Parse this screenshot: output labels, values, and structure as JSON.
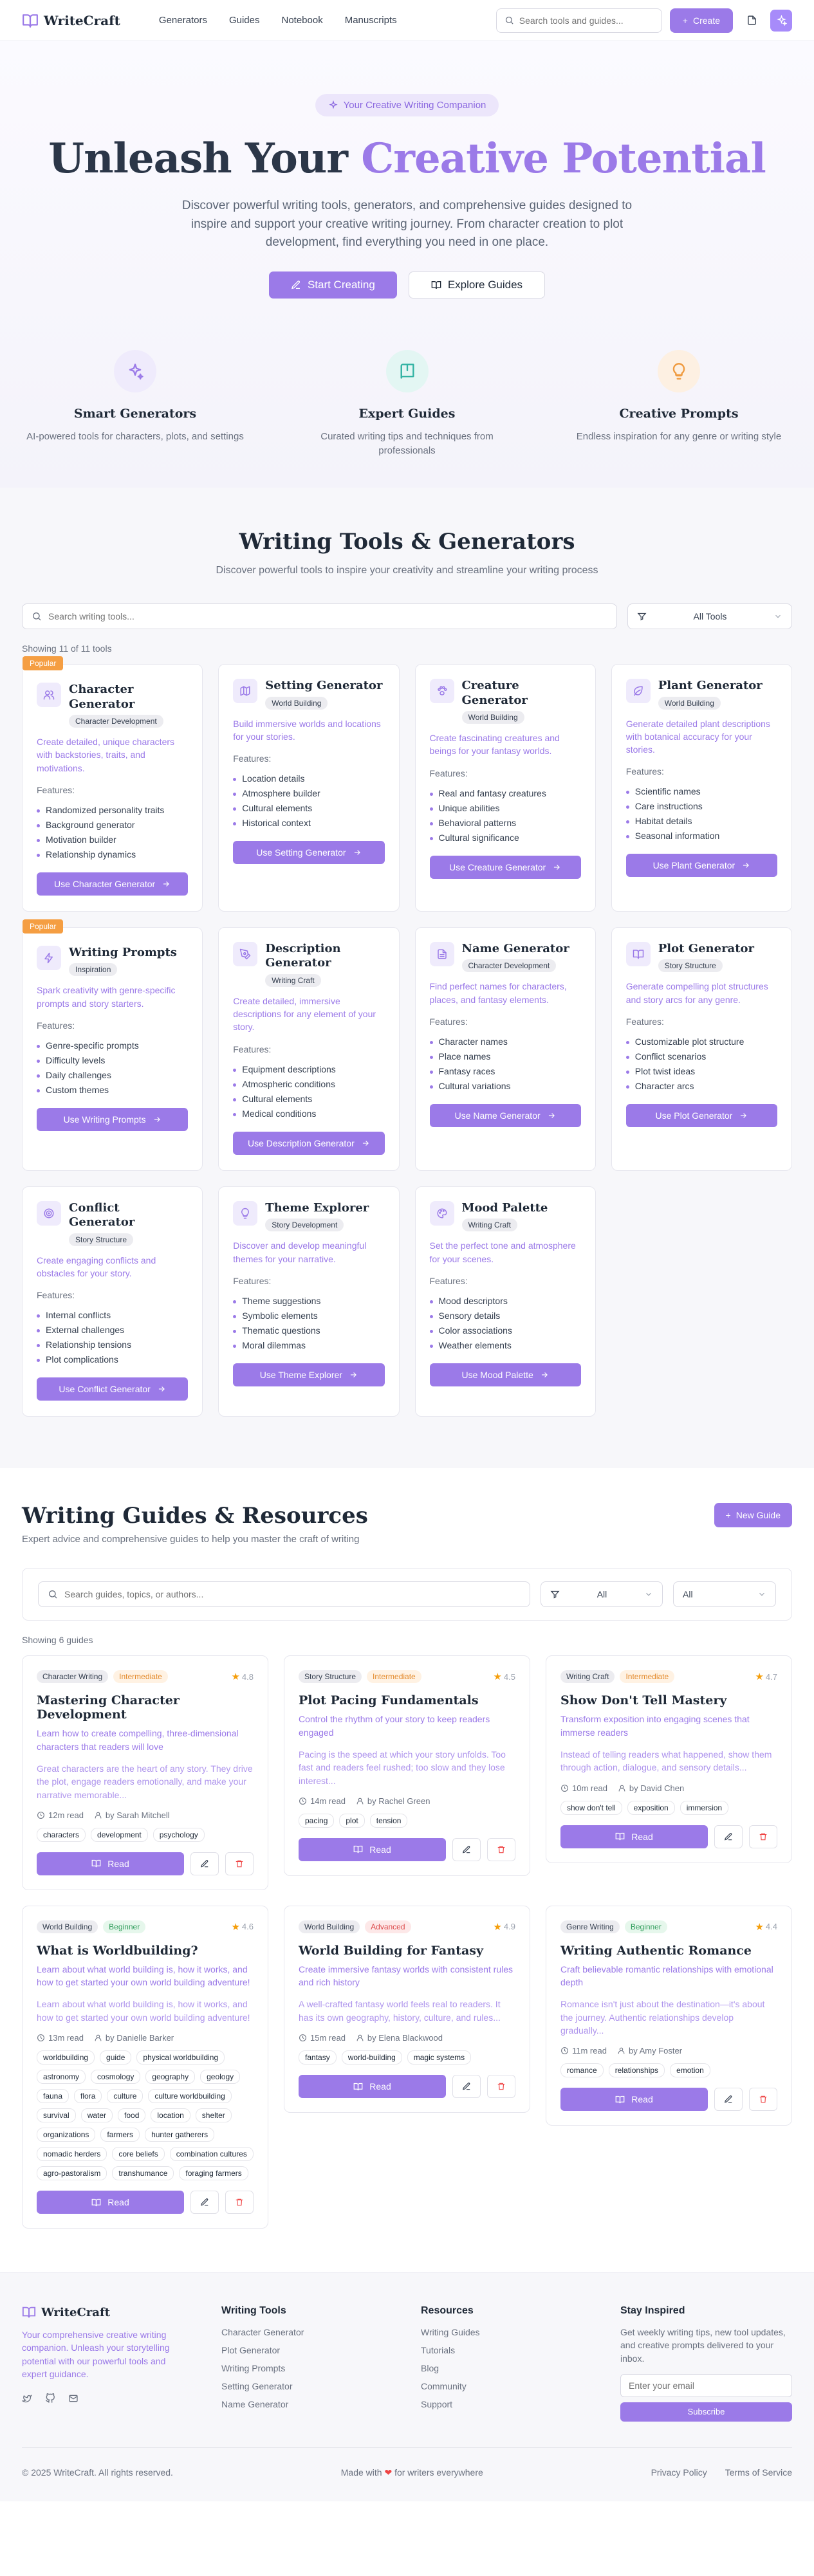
{
  "header": {
    "brand": "WriteCraft",
    "nav": [
      "Generators",
      "Guides",
      "Notebook",
      "Manuscripts"
    ],
    "search_placeholder": "Search tools and guides...",
    "create_label": "Create"
  },
  "hero": {
    "pill": "Your Creative Writing Companion",
    "title_a": "Unleash Your",
    "title_b": "Creative Potential",
    "lead": "Discover powerful writing tools, generators, and comprehensive guides designed to inspire and support your creative writing journey. From character creation to plot development, find everything you need in one place.",
    "btn_primary": "Start Creating",
    "btn_secondary": "Explore Guides",
    "features": [
      {
        "title": "Smart Generators",
        "desc": "AI-powered tools for characters, plots, and settings",
        "icon": "sparkles-icon",
        "bg": "#efebfc",
        "color": "#9b7ae8"
      },
      {
        "title": "Expert Guides",
        "desc": "Curated writing tips and techniques from professionals",
        "icon": "book-icon",
        "bg": "#e3f6f3",
        "color": "#32b3a3"
      },
      {
        "title": "Creative Prompts",
        "desc": "Endless inspiration for any genre or writing style",
        "icon": "lightbulb-icon",
        "bg": "#fdf0e2",
        "color": "#ef9a3e"
      }
    ]
  },
  "tools": {
    "title": "Writing Tools & Generators",
    "subtitle": "Discover powerful tools to inspire your creativity and streamline your writing process",
    "search_placeholder": "Search writing tools...",
    "filter_label": "All Tools",
    "count": "Showing 11 of 11 tools",
    "features_label": "Features:",
    "popular_label": "Popular",
    "items": [
      {
        "title": "Character Generator",
        "tag": "Character Development",
        "popular": true,
        "icon": "users-icon",
        "desc": "Create detailed, unique characters with backstories, traits, and motivations.",
        "features": [
          "Randomized personality traits",
          "Background generator",
          "Motivation builder",
          "Relationship dynamics"
        ],
        "btn": "Use Character Generator"
      },
      {
        "title": "Setting Generator",
        "tag": "World Building",
        "popular": false,
        "icon": "map-icon",
        "desc": "Build immersive worlds and locations for your stories.",
        "features": [
          "Location details",
          "Atmosphere builder",
          "Cultural elements",
          "Historical context"
        ],
        "btn": "Use Setting Generator"
      },
      {
        "title": "Creature Generator",
        "tag": "World Building",
        "popular": false,
        "icon": "paw-icon",
        "desc": "Create fascinating creatures and beings for your fantasy worlds.",
        "features": [
          "Real and fantasy creatures",
          "Unique abilities",
          "Behavioral patterns",
          "Cultural significance"
        ],
        "btn": "Use Creature Generator"
      },
      {
        "title": "Plant Generator",
        "tag": "World Building",
        "popular": false,
        "icon": "leaf-icon",
        "desc": "Generate detailed plant descriptions with botanical accuracy for your stories.",
        "features": [
          "Scientific names",
          "Care instructions",
          "Habitat details",
          "Seasonal information"
        ],
        "btn": "Use Plant Generator"
      },
      {
        "title": "Writing Prompts",
        "tag": "Inspiration",
        "popular": true,
        "icon": "bolt-icon",
        "desc": "Spark creativity with genre-specific prompts and story starters.",
        "features": [
          "Genre-specific prompts",
          "Difficulty levels",
          "Daily challenges",
          "Custom themes"
        ],
        "btn": "Use Writing Prompts"
      },
      {
        "title": "Description Generator",
        "tag": "Writing Craft",
        "popular": false,
        "icon": "pen-tool-icon",
        "desc": "Create detailed, immersive descriptions for any element of your story.",
        "features": [
          "Equipment descriptions",
          "Atmospheric conditions",
          "Cultural elements",
          "Medical conditions"
        ],
        "btn": "Use Description Generator"
      },
      {
        "title": "Name Generator",
        "tag": "Character Development",
        "popular": false,
        "icon": "file-text-icon",
        "desc": "Find perfect names for characters, places, and fantasy elements.",
        "features": [
          "Character names",
          "Place names",
          "Fantasy races",
          "Cultural variations"
        ],
        "btn": "Use Name Generator"
      },
      {
        "title": "Plot Generator",
        "tag": "Story Structure",
        "popular": false,
        "icon": "book-open-icon",
        "desc": "Generate compelling plot structures and story arcs for any genre.",
        "features": [
          "Customizable plot structure",
          "Conflict scenarios",
          "Plot twist ideas",
          "Character arcs"
        ],
        "btn": "Use Plot Generator"
      },
      {
        "title": "Conflict Generator",
        "tag": "Story Structure",
        "popular": false,
        "icon": "target-icon",
        "desc": "Create engaging conflicts and obstacles for your story.",
        "features": [
          "Internal conflicts",
          "External challenges",
          "Relationship tensions",
          "Plot complications"
        ],
        "btn": "Use Conflict Generator"
      },
      {
        "title": "Theme Explorer",
        "tag": "Story Development",
        "popular": false,
        "icon": "lightbulb-icon",
        "desc": "Discover and develop meaningful themes for your narrative.",
        "features": [
          "Theme suggestions",
          "Symbolic elements",
          "Thematic questions",
          "Moral dilemmas"
        ],
        "btn": "Use Theme Explorer"
      },
      {
        "title": "Mood Palette",
        "tag": "Writing Craft",
        "popular": false,
        "icon": "palette-icon",
        "desc": "Set the perfect tone and atmosphere for your scenes.",
        "features": [
          "Mood descriptors",
          "Sensory details",
          "Color associations",
          "Weather elements"
        ],
        "btn": "Use Mood Palette"
      }
    ]
  },
  "guides": {
    "title": "Writing Guides & Resources",
    "subtitle": "Expert advice and comprehensive guides to help you master the craft of writing",
    "new_label": "New Guide",
    "search_placeholder": "Search guides, topics, or authors...",
    "filter1": "All",
    "filter2": "All",
    "count": "Showing 6 guides",
    "read_label": "Read",
    "items": [
      {
        "category": "Character Writing",
        "level": "Intermediate",
        "rating": "4.8",
        "title": "Mastering Character Development",
        "subtitle": "Learn how to create compelling, three-dimensional characters that readers will love",
        "excerpt": "Great characters are the heart of any story. They drive the plot, engage readers emotionally, and make your narrative memorable...",
        "time": "12m read",
        "author": "by Sarah Mitchell",
        "tags": [
          "characters",
          "development",
          "psychology"
        ]
      },
      {
        "category": "Story Structure",
        "level": "Intermediate",
        "rating": "4.5",
        "title": "Plot Pacing Fundamentals",
        "subtitle": "Control the rhythm of your story to keep readers engaged",
        "excerpt": "Pacing is the speed at which your story unfolds. Too fast and readers feel rushed; too slow and they lose interest...",
        "time": "14m read",
        "author": "by Rachel Green",
        "tags": [
          "pacing",
          "plot",
          "tension"
        ]
      },
      {
        "category": "Writing Craft",
        "level": "Intermediate",
        "rating": "4.7",
        "title": "Show Don't Tell Mastery",
        "subtitle": "Transform exposition into engaging scenes that immerse readers",
        "excerpt": "Instead of telling readers what happened, show them through action, dialogue, and sensory details...",
        "time": "10m read",
        "author": "by David Chen",
        "tags": [
          "show don't tell",
          "exposition",
          "immersion"
        ]
      },
      {
        "category": "World Building",
        "level": "Beginner",
        "rating": "4.6",
        "title": "What is Worldbuilding?",
        "subtitle": "Learn about what world building is, how it works, and how to get started your own world building adventure!",
        "excerpt": "Learn about what world building is, how it works, and how to get started your own world building adventure!",
        "time": "13m read",
        "author": "by Danielle Barker",
        "tags": [
          "worldbuilding",
          "guide",
          "physical worldbuilding",
          "astronomy",
          "cosmology",
          "geography",
          "geology",
          "fauna",
          "flora",
          "culture",
          "culture worldbuilding",
          "survival",
          "water",
          "food",
          "location",
          "shelter",
          "organizations",
          "farmers",
          "hunter gatherers",
          "nomadic herders",
          "core beliefs",
          "combination cultures",
          "agro-pastoralism",
          "transhumance",
          "foraging farmers"
        ]
      },
      {
        "category": "World Building",
        "level": "Advanced",
        "rating": "4.9",
        "title": "World Building for Fantasy",
        "subtitle": "Create immersive fantasy worlds with consistent rules and rich history",
        "excerpt": "A well-crafted fantasy world feels real to readers. It has its own geography, history, culture, and rules...",
        "time": "15m read",
        "author": "by Elena Blackwood",
        "tags": [
          "fantasy",
          "world-building",
          "magic systems"
        ]
      },
      {
        "category": "Genre Writing",
        "level": "Beginner",
        "rating": "4.4",
        "title": "Writing Authentic Romance",
        "subtitle": "Craft believable romantic relationships with emotional depth",
        "excerpt": "Romance isn't just about the destination—it's about the journey. Authentic relationships develop gradually...",
        "time": "11m read",
        "author": "by Amy Foster",
        "tags": [
          "romance",
          "relationships",
          "emotion"
        ]
      }
    ]
  },
  "footer": {
    "brand": "WriteCraft",
    "about": "Your comprehensive creative writing companion. Unleash your storytelling potential with our powerful tools and expert guidance.",
    "col1_title": "Writing Tools",
    "col1": [
      "Character Generator",
      "Plot Generator",
      "Writing Prompts",
      "Setting Generator",
      "Name Generator"
    ],
    "col2_title": "Resources",
    "col2": [
      "Writing Guides",
      "Tutorials",
      "Blog",
      "Community",
      "Support"
    ],
    "news_title": "Stay Inspired",
    "news_text": "Get weekly writing tips, new tool updates, and creative prompts delivered to your inbox.",
    "email_placeholder": "Enter your email",
    "subscribe": "Subscribe",
    "copyright": "© 2025 WriteCraft. All rights reserved.",
    "made_a": "Made with",
    "made_b": "for writers everywhere",
    "privacy": "Privacy Policy",
    "terms": "Terms of Service"
  }
}
